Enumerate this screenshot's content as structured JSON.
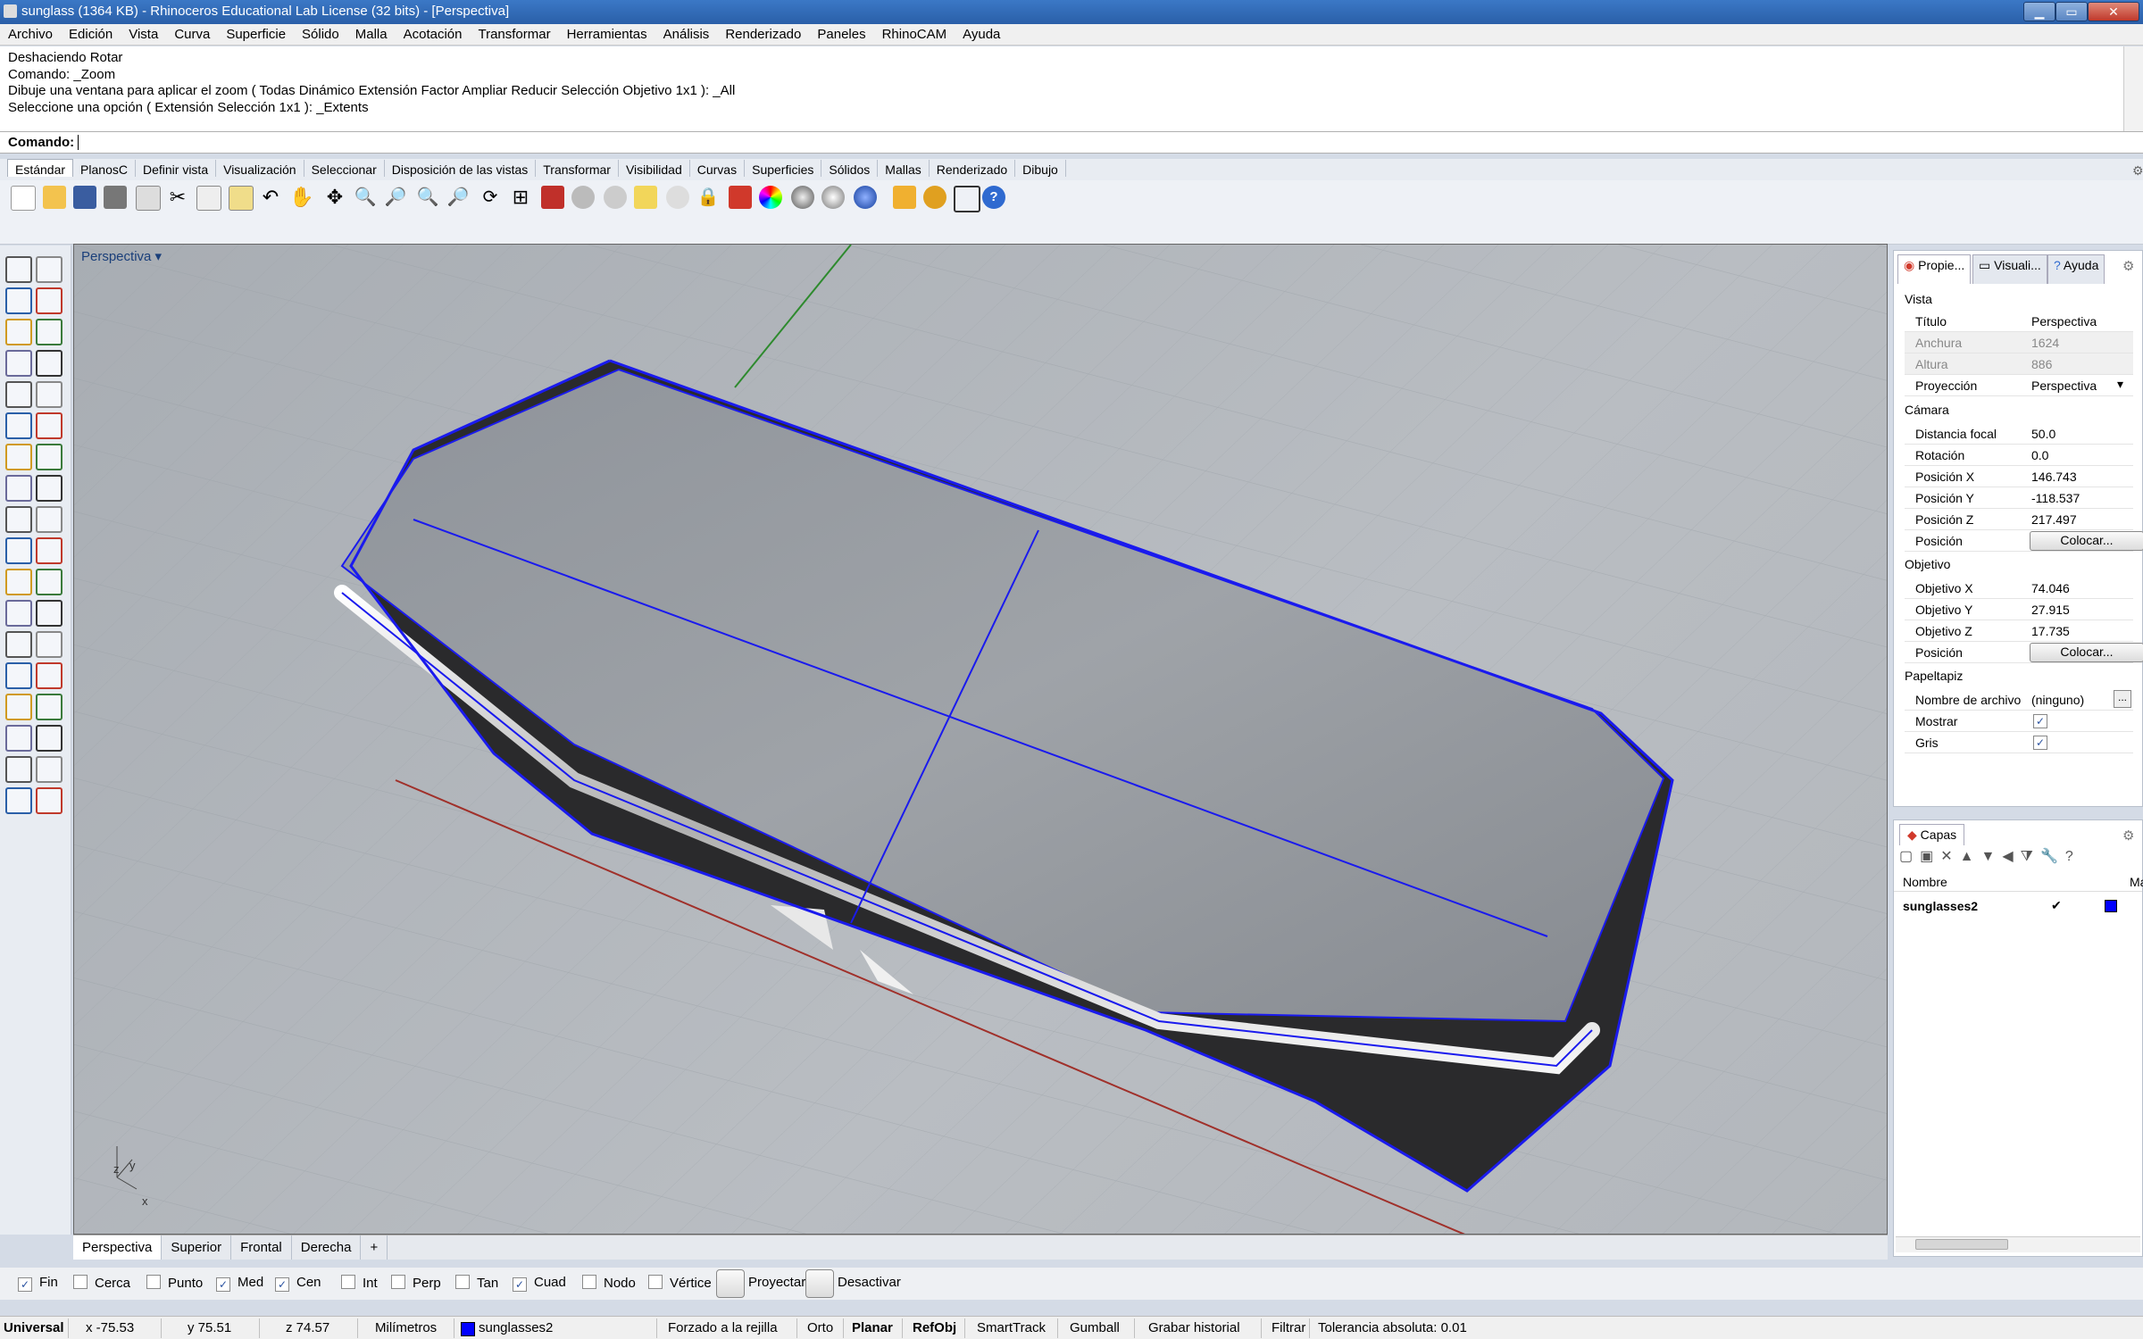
{
  "window": {
    "title": "sunglass (1364 KB) - Rhinoceros Educational Lab License (32 bits) - [Perspectiva]",
    "min": "▁",
    "max": "▭",
    "close": "✕"
  },
  "menu": [
    "Archivo",
    "Edición",
    "Vista",
    "Curva",
    "Superficie",
    "Sólido",
    "Malla",
    "Acotación",
    "Transformar",
    "Herramientas",
    "Análisis",
    "Renderizado",
    "Paneles",
    "RhinoCAM",
    "Ayuda"
  ],
  "command_history": [
    "Deshaciendo Rotar",
    "Comando: _Zoom",
    "Dibuje una ventana para aplicar el zoom ( Todas  Dinámico  Extensión  Factor  Ampliar  Reducir  Selección  Objetivo  1x1 ): _All",
    "Seleccione una opción ( Extensión  Selección  1x1 ): _Extents"
  ],
  "command_prompt": "Comando:",
  "toolbar_tabs": [
    "Estándar",
    "PlanosC",
    "Definir vista",
    "Visualización",
    "Seleccionar",
    "Disposición de las vistas",
    "Transformar",
    "Visibilidad",
    "Curvas",
    "Superficies",
    "Sólidos",
    "Mallas",
    "Renderizado",
    "Dibujo"
  ],
  "viewport": {
    "title": "Perspectiva",
    "axis_z": "z",
    "axis_y": "y",
    "axis_x": "x"
  },
  "viewport_tabs": [
    "Perspectiva",
    "Superior",
    "Frontal",
    "Derecha",
    "+"
  ],
  "osnaps": [
    {
      "label": "Fin",
      "checked": true
    },
    {
      "label": "Cerca",
      "checked": false
    },
    {
      "label": "Punto",
      "checked": false
    },
    {
      "label": "Med",
      "checked": true
    },
    {
      "label": "Cen",
      "checked": true
    },
    {
      "label": "Int",
      "checked": false
    },
    {
      "label": "Perp",
      "checked": false
    },
    {
      "label": "Tan",
      "checked": false
    },
    {
      "label": "Cuad",
      "checked": true
    },
    {
      "label": "Nodo",
      "checked": false
    },
    {
      "label": "Vértice",
      "checked": false
    }
  ],
  "osnap_buttons": {
    "project": "Proyectar",
    "disable": "Desactivar"
  },
  "status": {
    "cplane": "Universal",
    "x": "x -75.53",
    "y": "y 75.51",
    "z": "z 74.57",
    "units": "Milímetros",
    "layer": "sunglasses2",
    "grid": "Forzado a la rejilla",
    "ortho": "Orto",
    "planar": "Planar",
    "osnap": "RefObj",
    "smarttrack": "SmartTrack",
    "gumball": "Gumball",
    "history": "Grabar historial",
    "filter": "Filtrar",
    "tolerance": "Tolerancia absoluta: 0.01"
  },
  "properties": {
    "tabs": [
      "Propie...",
      "Visuali...",
      "Ayuda"
    ],
    "vista": {
      "heading": "Vista",
      "titulo_k": "Título",
      "titulo_v": "Perspectiva",
      "ancho_k": "Anchura",
      "ancho_v": "1624",
      "alto_k": "Altura",
      "alto_v": "886",
      "proy_k": "Proyección",
      "proy_v": "Perspectiva"
    },
    "camara": {
      "heading": "Cámara",
      "focal_k": "Distancia focal",
      "focal_v": "50.0",
      "rot_k": "Rotación",
      "rot_v": "0.0",
      "px_k": "Posición X",
      "px_v": "146.743",
      "py_k": "Posición Y",
      "py_v": "-118.537",
      "pz_k": "Posición Z",
      "pz_v": "217.497",
      "pos_k": "Posición",
      "pos_btn": "Colocar..."
    },
    "objetivo": {
      "heading": "Objetivo",
      "ox_k": "Objetivo X",
      "ox_v": "74.046",
      "oy_k": "Objetivo Y",
      "oy_v": "27.915",
      "oz_k": "Objetivo Z",
      "oz_v": "17.735",
      "pos_k": "Posición",
      "pos_btn": "Colocar..."
    },
    "papel": {
      "heading": "Papeltapiz",
      "file_k": "Nombre de archivo",
      "file_v": "(ninguno)",
      "file_btn": "...",
      "show_k": "Mostrar",
      "gray_k": "Gris"
    }
  },
  "layers": {
    "title": "Capas",
    "col_name": "Nombre",
    "col_mat": "Ma",
    "row_name": "sunglasses2",
    "row_check": "✔",
    "row_color": "#0000ff"
  }
}
